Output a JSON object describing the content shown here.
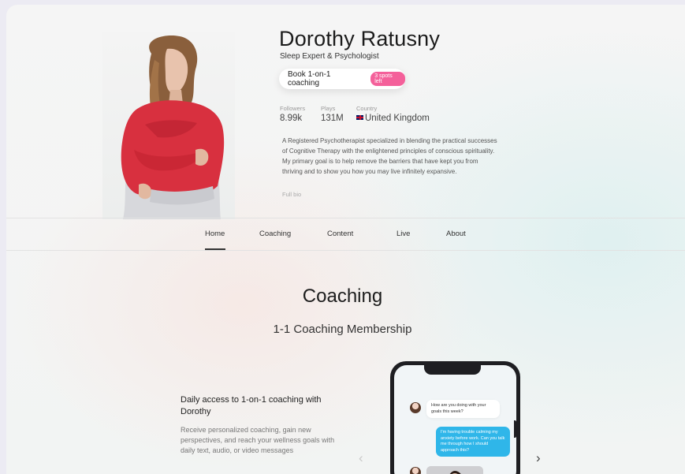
{
  "profile": {
    "name": "Dorothy Ratusny",
    "subtitle": "Sleep Expert & Psychologist",
    "book_label": "Book 1-on-1 coaching",
    "spots_badge": "3 spots left",
    "stats": [
      {
        "label": "Followers",
        "value": "8.99k"
      },
      {
        "label": "Plays",
        "value": "131M"
      },
      {
        "label": "Country",
        "value": "United Kingdom"
      }
    ],
    "bio": "A Registered Psychotherapist specialized in blending the practical successes of Cognitive Therapy with the enlightened principles of conscious spirituality. My primary goal is to help remove the barriers that have kept you from thriving and to show you how you may live infinitely expansive.",
    "full_bio_label": "Full bio"
  },
  "nav": {
    "tabs": [
      "Home",
      "Coaching",
      "Content",
      "Live",
      "About"
    ],
    "active": "Home"
  },
  "coaching": {
    "title": "Coaching",
    "subtitle": "1-1 Coaching Membership",
    "feature_title": "Daily access to 1-on-1 coaching with Dorothy",
    "feature_text": "Receive personalized coaching, gain new perspectives, and reach your wellness goals with daily text, audio, or video messages",
    "prev_arrow": "‹",
    "next_arrow": "›",
    "chat": {
      "incoming": "How are you doing with your goals this week?",
      "outgoing": "I'm having trouble calming my anxiety before work. Can you talk me through how I should approach this?"
    }
  },
  "colors": {
    "badge": "#f4609a",
    "outgoing_bubble": "#2fb6e9",
    "accent_text": "#1b1b1b"
  }
}
